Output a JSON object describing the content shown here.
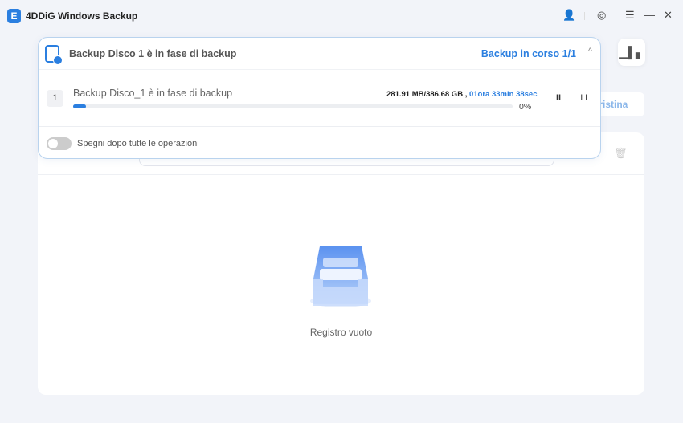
{
  "app": {
    "logo_letter": "E",
    "title": "4DDiG Windows Backup"
  },
  "titlebar": {
    "account": "👤",
    "settings": "◎",
    "menu": "☰",
    "minimize": "—",
    "close": "✕"
  },
  "background": {
    "stats_icon": "▁▌▖",
    "ripristina": "pristina",
    "trash": "🗑"
  },
  "empty": {
    "text": "Registro vuoto"
  },
  "popup": {
    "title": "Backup Disco  1 è in fase di backup",
    "status": "Backup in corso  1/1",
    "collapse": "^",
    "task": {
      "index": "1",
      "name": "Backup Disco_1 è in fase di backup",
      "size": "281.91 MB/386.68 GB , ",
      "eta": "01ora 33min 38sec",
      "percent_label": "0%",
      "progress": 0.03,
      "pause": "II",
      "delete": "⊔"
    },
    "shutdown_label": "Spegni dopo tutte le operazioni",
    "shutdown_on": false
  },
  "colors": {
    "accent": "#2b7fe0"
  }
}
